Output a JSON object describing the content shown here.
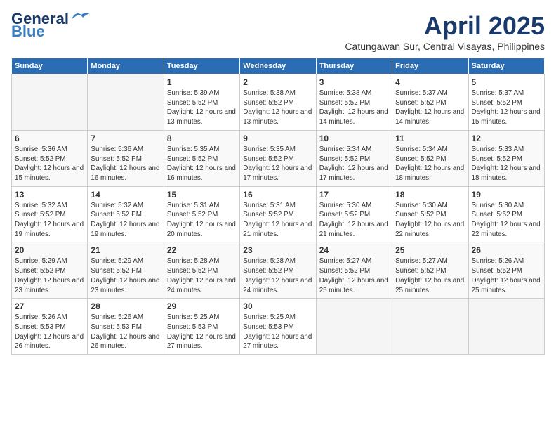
{
  "logo": {
    "line1": "General",
    "line2": "Blue"
  },
  "header": {
    "month": "April 2025",
    "location": "Catungawan Sur, Central Visayas, Philippines"
  },
  "weekdays": [
    "Sunday",
    "Monday",
    "Tuesday",
    "Wednesday",
    "Thursday",
    "Friday",
    "Saturday"
  ],
  "weeks": [
    [
      {
        "day": "",
        "sunrise": "",
        "sunset": "",
        "daylight": "",
        "empty": true
      },
      {
        "day": "",
        "sunrise": "",
        "sunset": "",
        "daylight": "",
        "empty": true
      },
      {
        "day": "1",
        "sunrise": "Sunrise: 5:39 AM",
        "sunset": "Sunset: 5:52 PM",
        "daylight": "Daylight: 12 hours and 13 minutes.",
        "empty": false
      },
      {
        "day": "2",
        "sunrise": "Sunrise: 5:38 AM",
        "sunset": "Sunset: 5:52 PM",
        "daylight": "Daylight: 12 hours and 13 minutes.",
        "empty": false
      },
      {
        "day": "3",
        "sunrise": "Sunrise: 5:38 AM",
        "sunset": "Sunset: 5:52 PM",
        "daylight": "Daylight: 12 hours and 14 minutes.",
        "empty": false
      },
      {
        "day": "4",
        "sunrise": "Sunrise: 5:37 AM",
        "sunset": "Sunset: 5:52 PM",
        "daylight": "Daylight: 12 hours and 14 minutes.",
        "empty": false
      },
      {
        "day": "5",
        "sunrise": "Sunrise: 5:37 AM",
        "sunset": "Sunset: 5:52 PM",
        "daylight": "Daylight: 12 hours and 15 minutes.",
        "empty": false
      }
    ],
    [
      {
        "day": "6",
        "sunrise": "Sunrise: 5:36 AM",
        "sunset": "Sunset: 5:52 PM",
        "daylight": "Daylight: 12 hours and 15 minutes.",
        "empty": false
      },
      {
        "day": "7",
        "sunrise": "Sunrise: 5:36 AM",
        "sunset": "Sunset: 5:52 PM",
        "daylight": "Daylight: 12 hours and 16 minutes.",
        "empty": false
      },
      {
        "day": "8",
        "sunrise": "Sunrise: 5:35 AM",
        "sunset": "Sunset: 5:52 PM",
        "daylight": "Daylight: 12 hours and 16 minutes.",
        "empty": false
      },
      {
        "day": "9",
        "sunrise": "Sunrise: 5:35 AM",
        "sunset": "Sunset: 5:52 PM",
        "daylight": "Daylight: 12 hours and 17 minutes.",
        "empty": false
      },
      {
        "day": "10",
        "sunrise": "Sunrise: 5:34 AM",
        "sunset": "Sunset: 5:52 PM",
        "daylight": "Daylight: 12 hours and 17 minutes.",
        "empty": false
      },
      {
        "day": "11",
        "sunrise": "Sunrise: 5:34 AM",
        "sunset": "Sunset: 5:52 PM",
        "daylight": "Daylight: 12 hours and 18 minutes.",
        "empty": false
      },
      {
        "day": "12",
        "sunrise": "Sunrise: 5:33 AM",
        "sunset": "Sunset: 5:52 PM",
        "daylight": "Daylight: 12 hours and 18 minutes.",
        "empty": false
      }
    ],
    [
      {
        "day": "13",
        "sunrise": "Sunrise: 5:32 AM",
        "sunset": "Sunset: 5:52 PM",
        "daylight": "Daylight: 12 hours and 19 minutes.",
        "empty": false
      },
      {
        "day": "14",
        "sunrise": "Sunrise: 5:32 AM",
        "sunset": "Sunset: 5:52 PM",
        "daylight": "Daylight: 12 hours and 19 minutes.",
        "empty": false
      },
      {
        "day": "15",
        "sunrise": "Sunrise: 5:31 AM",
        "sunset": "Sunset: 5:52 PM",
        "daylight": "Daylight: 12 hours and 20 minutes.",
        "empty": false
      },
      {
        "day": "16",
        "sunrise": "Sunrise: 5:31 AM",
        "sunset": "Sunset: 5:52 PM",
        "daylight": "Daylight: 12 hours and 21 minutes.",
        "empty": false
      },
      {
        "day": "17",
        "sunrise": "Sunrise: 5:30 AM",
        "sunset": "Sunset: 5:52 PM",
        "daylight": "Daylight: 12 hours and 21 minutes.",
        "empty": false
      },
      {
        "day": "18",
        "sunrise": "Sunrise: 5:30 AM",
        "sunset": "Sunset: 5:52 PM",
        "daylight": "Daylight: 12 hours and 22 minutes.",
        "empty": false
      },
      {
        "day": "19",
        "sunrise": "Sunrise: 5:30 AM",
        "sunset": "Sunset: 5:52 PM",
        "daylight": "Daylight: 12 hours and 22 minutes.",
        "empty": false
      }
    ],
    [
      {
        "day": "20",
        "sunrise": "Sunrise: 5:29 AM",
        "sunset": "Sunset: 5:52 PM",
        "daylight": "Daylight: 12 hours and 23 minutes.",
        "empty": false
      },
      {
        "day": "21",
        "sunrise": "Sunrise: 5:29 AM",
        "sunset": "Sunset: 5:52 PM",
        "daylight": "Daylight: 12 hours and 23 minutes.",
        "empty": false
      },
      {
        "day": "22",
        "sunrise": "Sunrise: 5:28 AM",
        "sunset": "Sunset: 5:52 PM",
        "daylight": "Daylight: 12 hours and 24 minutes.",
        "empty": false
      },
      {
        "day": "23",
        "sunrise": "Sunrise: 5:28 AM",
        "sunset": "Sunset: 5:52 PM",
        "daylight": "Daylight: 12 hours and 24 minutes.",
        "empty": false
      },
      {
        "day": "24",
        "sunrise": "Sunrise: 5:27 AM",
        "sunset": "Sunset: 5:52 PM",
        "daylight": "Daylight: 12 hours and 25 minutes.",
        "empty": false
      },
      {
        "day": "25",
        "sunrise": "Sunrise: 5:27 AM",
        "sunset": "Sunset: 5:52 PM",
        "daylight": "Daylight: 12 hours and 25 minutes.",
        "empty": false
      },
      {
        "day": "26",
        "sunrise": "Sunrise: 5:26 AM",
        "sunset": "Sunset: 5:52 PM",
        "daylight": "Daylight: 12 hours and 25 minutes.",
        "empty": false
      }
    ],
    [
      {
        "day": "27",
        "sunrise": "Sunrise: 5:26 AM",
        "sunset": "Sunset: 5:53 PM",
        "daylight": "Daylight: 12 hours and 26 minutes.",
        "empty": false
      },
      {
        "day": "28",
        "sunrise": "Sunrise: 5:26 AM",
        "sunset": "Sunset: 5:53 PM",
        "daylight": "Daylight: 12 hours and 26 minutes.",
        "empty": false
      },
      {
        "day": "29",
        "sunrise": "Sunrise: 5:25 AM",
        "sunset": "Sunset: 5:53 PM",
        "daylight": "Daylight: 12 hours and 27 minutes.",
        "empty": false
      },
      {
        "day": "30",
        "sunrise": "Sunrise: 5:25 AM",
        "sunset": "Sunset: 5:53 PM",
        "daylight": "Daylight: 12 hours and 27 minutes.",
        "empty": false
      },
      {
        "day": "",
        "sunrise": "",
        "sunset": "",
        "daylight": "",
        "empty": true
      },
      {
        "day": "",
        "sunrise": "",
        "sunset": "",
        "daylight": "",
        "empty": true
      },
      {
        "day": "",
        "sunrise": "",
        "sunset": "",
        "daylight": "",
        "empty": true
      }
    ]
  ]
}
